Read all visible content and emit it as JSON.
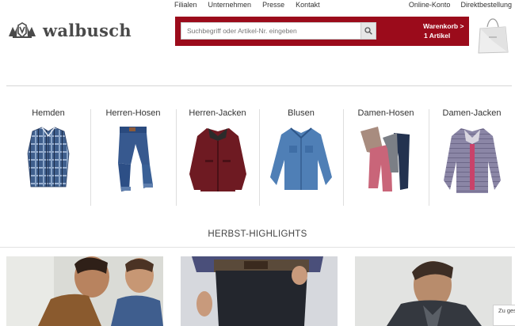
{
  "brand": {
    "name": "walbusch"
  },
  "top_nav": [
    "Filialen",
    "Unternehmen",
    "Presse",
    "Kontakt"
  ],
  "top_links": [
    "Online-Konto",
    "Direktbestellung"
  ],
  "search": {
    "placeholder": "Suchbegriff oder Artikel-Nr. eingeben"
  },
  "cart": {
    "line1": "Warenkorb >",
    "line2": "1 Artikel"
  },
  "categories": [
    {
      "label": "Hemden",
      "icon": "plaid-shirt"
    },
    {
      "label": "Herren-Hosen",
      "icon": "denim-jeans"
    },
    {
      "label": "Herren-Jacken",
      "icon": "burgundy-jacket"
    },
    {
      "label": "Blusen",
      "icon": "denim-blouse"
    },
    {
      "label": "Damen-Hosen",
      "icon": "women-trousers"
    },
    {
      "label": "Damen-Jacken",
      "icon": "quilted-jacket"
    }
  ],
  "section": {
    "title": "HERBST-HIGHLIGHTS"
  },
  "consent": {
    "text": "Zu gese"
  },
  "colors": {
    "accent": "#9b0b1b",
    "text": "#333333"
  }
}
